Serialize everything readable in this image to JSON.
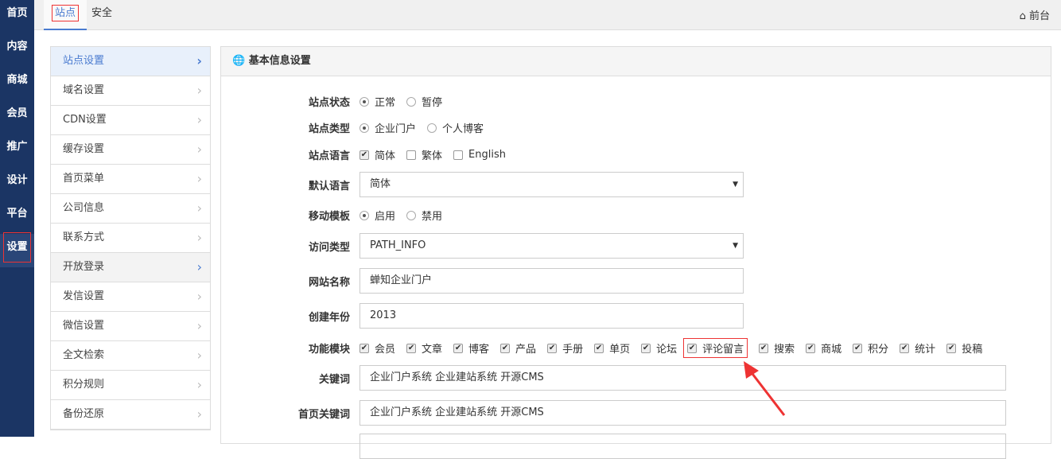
{
  "sidebar": [
    "首页",
    "内容",
    "商城",
    "会员",
    "推广",
    "设计",
    "平台",
    "设置"
  ],
  "tabs": [
    "站点",
    "安全"
  ],
  "front_link": "前台",
  "menu": [
    "站点设置",
    "域名设置",
    "CDN设置",
    "缓存设置",
    "首页菜单",
    "公司信息",
    "联系方式",
    "开放登录",
    "发信设置",
    "微信设置",
    "全文检索",
    "积分规则",
    "备份还原"
  ],
  "panel_title": "基本信息设置",
  "form": {
    "status": {
      "label": "站点状态",
      "options": [
        "正常",
        "暂停"
      ],
      "selected": "正常"
    },
    "type": {
      "label": "站点类型",
      "options": [
        "企业门户",
        "个人博客"
      ],
      "selected": "企业门户"
    },
    "lang": {
      "label": "站点语言",
      "options": [
        "简体",
        "繁体",
        "English"
      ],
      "checked": [
        "简体"
      ]
    },
    "default_lang": {
      "label": "默认语言",
      "value": "简体"
    },
    "mobile": {
      "label": "移动模板",
      "options": [
        "启用",
        "禁用"
      ],
      "selected": "启用"
    },
    "access": {
      "label": "访问类型",
      "value": "PATH_INFO"
    },
    "site_name": {
      "label": "网站名称",
      "value": "蝉知企业门户"
    },
    "year": {
      "label": "创建年份",
      "value": "2013"
    },
    "modules": {
      "label": "功能模块",
      "options": [
        "会员",
        "文章",
        "博客",
        "产品",
        "手册",
        "单页",
        "论坛",
        "评论留言",
        "搜索",
        "商城",
        "积分",
        "统计",
        "投稿"
      ]
    },
    "keywords": {
      "label": "关键词",
      "value": "企业门户系统 企业建站系统 开源CMS"
    },
    "home_keywords": {
      "label": "首页关键词",
      "value": "企业门户系统 企业建站系统 开源CMS"
    }
  }
}
